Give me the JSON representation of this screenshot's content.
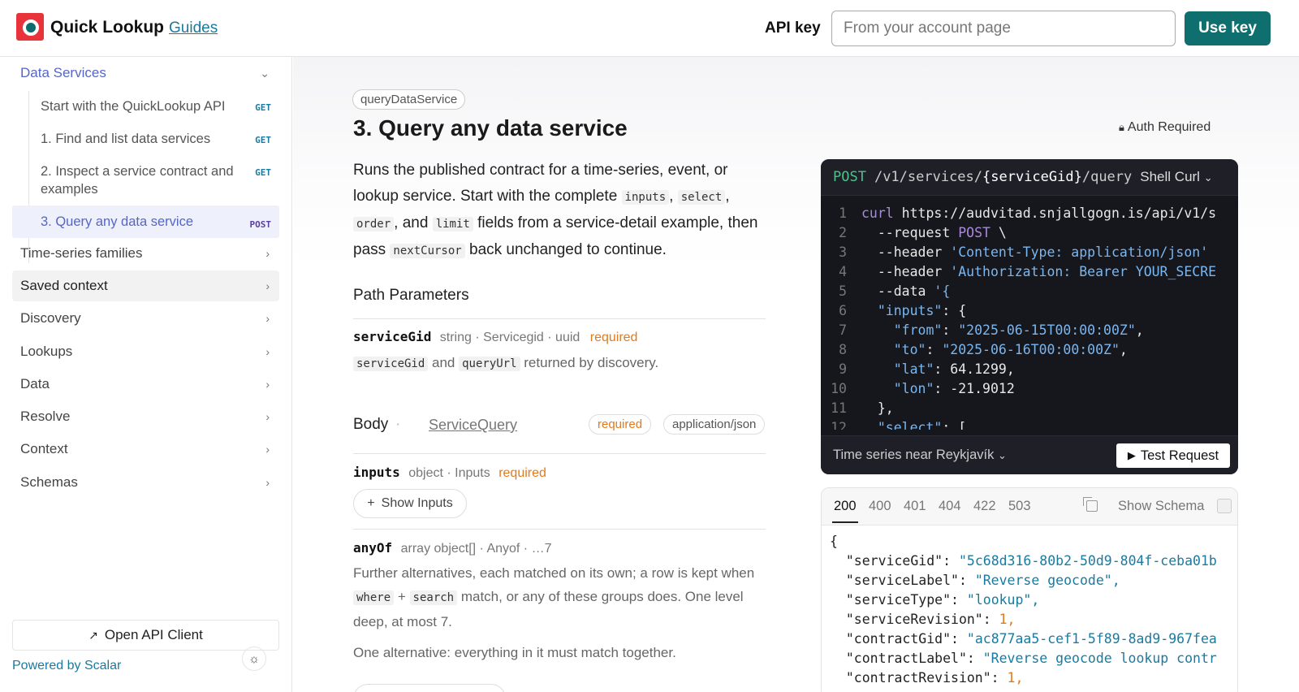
{
  "header": {
    "app_name": "Quick Lookup",
    "guides": "Guides",
    "api_key_label": "API key",
    "api_key_placeholder": "From your account page",
    "use_key": "Use key"
  },
  "sidebar": {
    "section": "Data Services",
    "sub_items": [
      {
        "label": "Start with the QuickLookup API",
        "method": "GET"
      },
      {
        "label": "1. Find and list data services",
        "method": "GET"
      },
      {
        "label": "2. Inspect a service contract and examples",
        "method": "GET"
      },
      {
        "label": "3. Query any data service",
        "method": "POST"
      }
    ],
    "groups": [
      "Time-series families",
      "Saved context",
      "Discovery",
      "Lookups",
      "Data",
      "Resolve",
      "Context",
      "Schemas"
    ],
    "open_client": "Open API Client",
    "powered_by": "Powered by Scalar"
  },
  "main": {
    "operation_id": "queryDataService",
    "title": "3. Query any data service",
    "auth": "Auth Required",
    "desc": {
      "p1": "Runs the published contract for a time-series, event, or lookup service. Start with the complete ",
      "c1": "inputs",
      "s1": ", ",
      "c2": "select",
      "s2": ", ",
      "c3": "order",
      "s3": ", and ",
      "c4": "limit",
      "p2": " fields from a service-detail example, then pass ",
      "c5": "nextCursor",
      "p3": " back unchanged to continue."
    },
    "path_params_heading": "Path Parameters",
    "service_gid": {
      "name": "serviceGid",
      "meta": "string · Servicegid · uuid",
      "required": "required",
      "desc_code1": "serviceGid",
      "desc_mid": " and ",
      "desc_code2": "queryUrl",
      "desc_end": " returned by discovery."
    },
    "body": {
      "heading": "Body",
      "dot": "·",
      "schema": "ServiceQuery",
      "required": "required",
      "content_type": "application/json"
    },
    "inputs": {
      "name": "inputs",
      "meta": "object · Inputs",
      "required": "required",
      "show": "Show Inputs"
    },
    "anyof": {
      "name": "anyOf",
      "meta": "array object[] · Anyof · …7",
      "d1": "Further alternatives, each matched on its own; a row is kept when ",
      "c1": "where",
      "d2": " + ",
      "c2": "search",
      "d3": " match, or any of these groups does. One level deep, at most 7.",
      "d4": "One alternative: everything in it must match together."
    }
  },
  "code": {
    "method": "POST",
    "path_a": "/v1/services/",
    "path_b": "{serviceGid}",
    "path_c": "/query",
    "lang": "Shell Curl",
    "lines": [
      "curl https://audvitad.snjallgogn.is/api/v1/s",
      "  --request POST \\",
      "  --header 'Content-Type: application/json'",
      "  --header 'Authorization: Bearer YOUR_SECRE",
      "  --data '{",
      "  \"inputs\": {",
      "    \"from\": \"2025-06-15T00:00:00Z\",",
      "    \"to\": \"2025-06-16T00:00:00Z\",",
      "    \"lat\": 64.1299,",
      "    \"lon\": -21.9012",
      "  },",
      "  \"select\": ["
    ],
    "example": "Time series near Reykjavík",
    "test": "Test Request"
  },
  "response": {
    "tabs": [
      "200",
      "400",
      "401",
      "404",
      "422",
      "503"
    ],
    "show_schema": "Show Schema",
    "json": [
      {
        "k": "{",
        "v": "",
        "t": ""
      },
      {
        "k": "  \"serviceGid\": ",
        "v": "\"5c68d316-80b2-50d9-804f-ceba01b",
        "t": "str"
      },
      {
        "k": "  \"serviceLabel\": ",
        "v": "\"Reverse geocode\",",
        "t": "str"
      },
      {
        "k": "  \"serviceType\": ",
        "v": "\"lookup\",",
        "t": "str"
      },
      {
        "k": "  \"serviceRevision\": ",
        "v": "1,",
        "t": "num"
      },
      {
        "k": "  \"contractGid\": ",
        "v": "\"ac877aa5-cef1-5f89-8ad9-967fea",
        "t": "str"
      },
      {
        "k": "  \"contractLabel\": ",
        "v": "\"Reverse geocode lookup contr",
        "t": "str"
      },
      {
        "k": "  \"contractRevision\": ",
        "v": "1,",
        "t": "num"
      }
    ]
  }
}
